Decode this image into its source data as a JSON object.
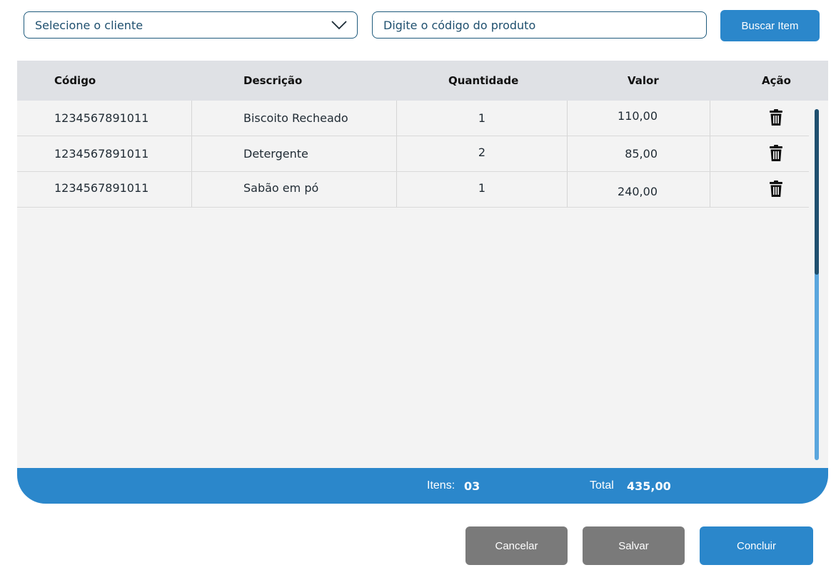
{
  "toolbar": {
    "client_select": {
      "value": "Selecione o cliente",
      "icon": "chevron-down-icon"
    },
    "product_code": {
      "placeholder": "Digite o código do produto"
    },
    "search_label": "Buscar Item"
  },
  "table": {
    "headers": {
      "code": "Código",
      "description": "Descrição",
      "quantity": "Quantidade",
      "value": "Valor",
      "action": "Ação"
    },
    "rows": [
      {
        "code": "1234567891011",
        "description": "Biscoito Recheado",
        "quantity": "1",
        "value": "110,00",
        "action_icon": "trash-icon"
      },
      {
        "code": "1234567891011",
        "description": "Detergente",
        "quantity": "2",
        "value": "85,00",
        "action_icon": "trash-icon"
      },
      {
        "code": "1234567891011",
        "description": "Sabão em pó",
        "quantity": "1",
        "value": "240,00",
        "action_icon": "trash-icon"
      }
    ]
  },
  "summary": {
    "items_label": "Itens:",
    "items_value": "03",
    "total_label": "Total",
    "total_value": "435,00"
  },
  "actions": {
    "cancel_label": "Cancelar",
    "save_label": "Salvar",
    "finish_label": "Concluir"
  },
  "colors": {
    "primary": "#2b87cb",
    "secondary": "#7a7a7a",
    "border": "#1e5a7c",
    "header_bg": "#dfe1e5",
    "panel_bg": "#f3f3f3"
  }
}
